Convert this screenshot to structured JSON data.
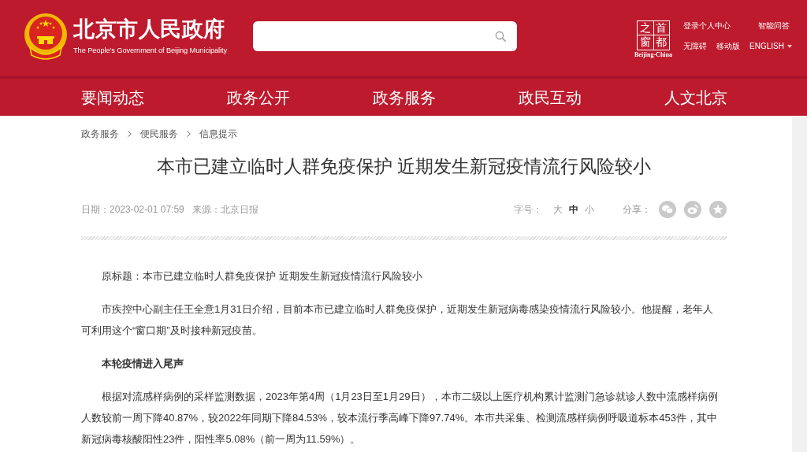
{
  "header": {
    "title": "北京市人民政府",
    "subtitle": "The People's Government of Beijing Municipality",
    "portal_logo": {
      "characters": [
        "之",
        "首",
        "窗",
        "都"
      ],
      "caption": "Beijing-China"
    },
    "links": [
      "登录个人中心",
      "智能问答",
      "无障碍",
      "移动版"
    ],
    "language": "ENGLISH"
  },
  "nav": [
    "要闻动态",
    "政务公开",
    "政务服务",
    "政民互动",
    "人文北京"
  ],
  "breadcrumb": [
    "政务服务",
    "便民服务",
    "信息提示"
  ],
  "article": {
    "title": "本市已建立临时人群免疫保护 近期发生新冠疫情流行风险较小",
    "date": "日期：2023-02-01 07:59",
    "source": "来源：北京日报",
    "font_size": {
      "label": "字号：",
      "options": [
        {
          "label": "大",
          "selected": false
        },
        {
          "label": "中",
          "selected": true
        },
        {
          "label": "小",
          "selected": false
        }
      ]
    },
    "share_label": "分享：",
    "paragraphs": [
      {
        "kind": "text",
        "text": "原标题：本市已建立临时人群免疫保护 近期发生新冠疫情流行风险较小"
      },
      {
        "kind": "text",
        "text": "市疾控中心副主任王全意1月31日介绍，目前本市已建立临时人群免疫保护，近期发生新冠病毒感染疫情流行风险较小。他提醒，老年人可利用这个“窗口期”及时接种新冠疫苗。"
      },
      {
        "kind": "heading",
        "text": "本轮疫情进入尾声"
      },
      {
        "kind": "text",
        "text": "根据对流感样病例的采样监测数据，2023年第4周（1月23日至1月29日），本市二级以上医疗机构累计监测门急诊就诊人数中流感样病例人数较前一周下降40.87%，较2022年同期下降84.53%，较本流行季高峰下降97.74%。本市共采集、检测流感样病例呼吸道标本453件，其中新冠病毒核酸阳性23件，阳性率5.08%（前一周为11.59%）。"
      }
    ]
  }
}
